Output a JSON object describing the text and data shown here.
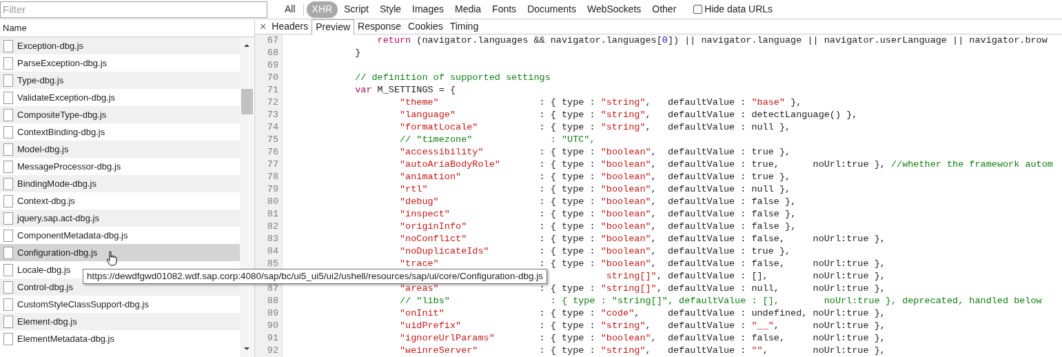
{
  "filter": {
    "placeholder": "Filter"
  },
  "type_filters": [
    {
      "label": "All",
      "selected": false
    },
    {
      "label": "XHR",
      "selected": true
    },
    {
      "label": "Script",
      "selected": false
    },
    {
      "label": "Style",
      "selected": false
    },
    {
      "label": "Images",
      "selected": false
    },
    {
      "label": "Media",
      "selected": false
    },
    {
      "label": "Fonts",
      "selected": false
    },
    {
      "label": "Documents",
      "selected": false
    },
    {
      "label": "WebSockets",
      "selected": false
    },
    {
      "label": "Other",
      "selected": false
    }
  ],
  "hide_data_urls": {
    "label": "Hide data URLs",
    "checked": false
  },
  "requests": {
    "column": "Name",
    "rows": [
      {
        "name": "Exception-dbg.js",
        "hovered": false
      },
      {
        "name": "ParseException-dbg.js",
        "hovered": false
      },
      {
        "name": "Type-dbg.js",
        "hovered": false
      },
      {
        "name": "ValidateException-dbg.js",
        "hovered": false
      },
      {
        "name": "CompositeType-dbg.js",
        "hovered": false
      },
      {
        "name": "ContextBinding-dbg.js",
        "hovered": false
      },
      {
        "name": "Model-dbg.js",
        "hovered": false
      },
      {
        "name": "MessageProcessor-dbg.js",
        "hovered": false
      },
      {
        "name": "BindingMode-dbg.js",
        "hovered": false
      },
      {
        "name": "Context-dbg.js",
        "hovered": false
      },
      {
        "name": "jquery.sap.act-dbg.js",
        "hovered": false
      },
      {
        "name": "ComponentMetadata-dbg.js",
        "hovered": false
      },
      {
        "name": "Configuration-dbg.js",
        "hovered": true
      },
      {
        "name": "Locale-dbg.js",
        "hovered": false
      },
      {
        "name": "Control-dbg.js",
        "hovered": false
      },
      {
        "name": "CustomStyleClassSupport-dbg.js",
        "hovered": false
      },
      {
        "name": "Element-dbg.js",
        "hovered": false
      },
      {
        "name": "ElementMetadata-dbg.js",
        "hovered": false
      }
    ]
  },
  "tooltip": "https://dewdfgwd01082.wdf.sap.corp:4080/sap/bc/ui5_ui5/ui2/ushell/resources/sap/ui/core/Configuration-dbg.js",
  "detail_tabs": {
    "close": "×",
    "tabs": [
      {
        "label": "Headers",
        "selected": false
      },
      {
        "label": "Preview",
        "selected": true
      },
      {
        "label": "Response",
        "selected": false
      },
      {
        "label": "Cookies",
        "selected": false
      },
      {
        "label": "Timing",
        "selected": false
      }
    ]
  },
  "code_lines": [
    {
      "number": "67",
      "kind": "inner",
      "tokens": [
        {
          "kind": "keyword",
          "text": "return"
        },
        {
          "kind": "plain",
          "text": " (navigator.languages && navigator.languages["
        },
        {
          "kind": "number",
          "text": "0"
        },
        {
          "kind": "plain",
          "text": "]) || navigator.language || navigator.userLanguage || navigator.brow"
        }
      ]
    },
    {
      "number": "68",
      "kind": "outer",
      "tokens": [
        {
          "kind": "plain",
          "text": "}"
        }
      ]
    },
    {
      "number": "69"
    },
    {
      "number": "70",
      "kind": "outer",
      "tokens": [
        {
          "kind": "comment",
          "text": "// definition of supported settings"
        }
      ]
    },
    {
      "number": "71",
      "kind": "outer",
      "tokens": [
        {
          "kind": "keyword",
          "text": "var"
        },
        {
          "kind": "plain",
          "text": " M_SETTINGS = {"
        }
      ]
    },
    {
      "number": "72",
      "kind": "entry",
      "tokens": [
        {
          "kind": "string",
          "text": "\"theme\""
        },
        {
          "kind": "plain",
          "text": "                  : { type : "
        },
        {
          "kind": "string",
          "text": "\"string\""
        },
        {
          "kind": "plain",
          "text": ",   defaultValue : "
        },
        {
          "kind": "string",
          "text": "\"base\""
        },
        {
          "kind": "plain",
          "text": " },"
        }
      ]
    },
    {
      "number": "73",
      "kind": "entry",
      "tokens": [
        {
          "kind": "string",
          "text": "\"language\""
        },
        {
          "kind": "plain",
          "text": "               : { type : "
        },
        {
          "kind": "string",
          "text": "\"string\""
        },
        {
          "kind": "plain",
          "text": ",   defaultValue : detectLanguage() },"
        }
      ]
    },
    {
      "number": "74",
      "kind": "entry",
      "tokens": [
        {
          "kind": "string",
          "text": "\"formatLocale\""
        },
        {
          "kind": "plain",
          "text": "           : { type : "
        },
        {
          "kind": "string",
          "text": "\"string\""
        },
        {
          "kind": "plain",
          "text": ",   defaultValue : null },"
        }
      ]
    },
    {
      "number": "75",
      "kind": "entry",
      "tokens": [
        {
          "kind": "comment",
          "text": "// \"timezone\"              : \"UTC\","
        }
      ]
    },
    {
      "number": "76",
      "kind": "entry",
      "tokens": [
        {
          "kind": "string",
          "text": "\"accessibility\""
        },
        {
          "kind": "plain",
          "text": "          : { type : "
        },
        {
          "kind": "string",
          "text": "\"boolean\""
        },
        {
          "kind": "plain",
          "text": ",  defaultValue : true },"
        }
      ]
    },
    {
      "number": "77",
      "kind": "entry",
      "tokens": [
        {
          "kind": "string",
          "text": "\"autoAriaBodyRole\""
        },
        {
          "kind": "plain",
          "text": "       : { type : "
        },
        {
          "kind": "string",
          "text": "\"boolean\""
        },
        {
          "kind": "plain",
          "text": ",  defaultValue : true,      noUrl:true }, "
        },
        {
          "kind": "comment",
          "text": "//whether the framework autom"
        }
      ]
    },
    {
      "number": "78",
      "kind": "entry",
      "tokens": [
        {
          "kind": "string",
          "text": "\"animation\""
        },
        {
          "kind": "plain",
          "text": "              : { type : "
        },
        {
          "kind": "string",
          "text": "\"boolean\""
        },
        {
          "kind": "plain",
          "text": ",  defaultValue : true },"
        }
      ]
    },
    {
      "number": "79",
      "kind": "entry",
      "tokens": [
        {
          "kind": "string",
          "text": "\"rtl\""
        },
        {
          "kind": "plain",
          "text": "                    : { type : "
        },
        {
          "kind": "string",
          "text": "\"boolean\""
        },
        {
          "kind": "plain",
          "text": ",  defaultValue : null },"
        }
      ]
    },
    {
      "number": "80",
      "kind": "entry",
      "tokens": [
        {
          "kind": "string",
          "text": "\"debug\""
        },
        {
          "kind": "plain",
          "text": "                  : { type : "
        },
        {
          "kind": "string",
          "text": "\"boolean\""
        },
        {
          "kind": "plain",
          "text": ",  defaultValue : false },"
        }
      ]
    },
    {
      "number": "81",
      "kind": "entry",
      "tokens": [
        {
          "kind": "string",
          "text": "\"inspect\""
        },
        {
          "kind": "plain",
          "text": "                : { type : "
        },
        {
          "kind": "string",
          "text": "\"boolean\""
        },
        {
          "kind": "plain",
          "text": ",  defaultValue : false },"
        }
      ]
    },
    {
      "number": "82",
      "kind": "entry",
      "tokens": [
        {
          "kind": "string",
          "text": "\"originInfo\""
        },
        {
          "kind": "plain",
          "text": "             : { type : "
        },
        {
          "kind": "string",
          "text": "\"boolean\""
        },
        {
          "kind": "plain",
          "text": ",  defaultValue : false },"
        }
      ]
    },
    {
      "number": "83",
      "kind": "entry",
      "tokens": [
        {
          "kind": "string",
          "text": "\"noConflict\""
        },
        {
          "kind": "plain",
          "text": "             : { type : "
        },
        {
          "kind": "string",
          "text": "\"boolean\""
        },
        {
          "kind": "plain",
          "text": ",  defaultValue : false,     noUrl:true },"
        }
      ]
    },
    {
      "number": "84",
      "kind": "entry",
      "tokens": [
        {
          "kind": "string",
          "text": "\"noDuplicateIds\""
        },
        {
          "kind": "plain",
          "text": "         : { type : "
        },
        {
          "kind": "string",
          "text": "\"boolean\""
        },
        {
          "kind": "plain",
          "text": ",  defaultValue : true },"
        }
      ]
    },
    {
      "number": "85",
      "kind": "entry",
      "tokens": [
        {
          "kind": "string",
          "text": "\"trace\""
        },
        {
          "kind": "plain",
          "text": "                  : { type : "
        },
        {
          "kind": "string",
          "text": "\"boolean\""
        },
        {
          "kind": "plain",
          "text": ",  defaultValue : false,     noUrl:true },"
        }
      ]
    },
    {
      "kind": "covered",
      "tokens": [
        {
          "kind": "string",
          "text": "string[]\""
        },
        {
          "kind": "plain",
          "text": ", defaultValue : [],        noUrl:true },"
        }
      ]
    },
    {
      "number": "87",
      "kind": "entry",
      "tokens": [
        {
          "kind": "string",
          "text": "\"areas\""
        },
        {
          "kind": "plain",
          "text": "                  : { type : "
        },
        {
          "kind": "string",
          "text": "\"string[]\""
        },
        {
          "kind": "plain",
          "text": ", defaultValue : null,      noUrl:true },"
        }
      ]
    },
    {
      "number": "88",
      "kind": "entry",
      "tokens": [
        {
          "kind": "comment",
          "text": "// \"libs\"                  : { type : \"string[]\", defaultValue : [],        noUrl:true }, deprecated, handled below"
        }
      ]
    },
    {
      "number": "89",
      "kind": "entry",
      "tokens": [
        {
          "kind": "string",
          "text": "\"onInit\""
        },
        {
          "kind": "plain",
          "text": "                 : { type : "
        },
        {
          "kind": "string",
          "text": "\"code\""
        },
        {
          "kind": "plain",
          "text": ",     defaultValue : undefined, noUrl:true },"
        }
      ]
    },
    {
      "number": "90",
      "kind": "entry",
      "tokens": [
        {
          "kind": "string",
          "text": "\"uidPrefix\""
        },
        {
          "kind": "plain",
          "text": "              : { type : "
        },
        {
          "kind": "string",
          "text": "\"string\""
        },
        {
          "kind": "plain",
          "text": ",   defaultValue : "
        },
        {
          "kind": "string",
          "text": "\"__\""
        },
        {
          "kind": "plain",
          "text": ",      noUrl:true },"
        }
      ]
    },
    {
      "number": "91",
      "kind": "entry",
      "tokens": [
        {
          "kind": "string",
          "text": "\"ignoreUrlParams\""
        },
        {
          "kind": "plain",
          "text": "        : { type : "
        },
        {
          "kind": "string",
          "text": "\"boolean\""
        },
        {
          "kind": "plain",
          "text": ",  defaultValue : false,     noUrl:true },"
        }
      ]
    },
    {
      "number": "92",
      "kind": "entry",
      "tokens": [
        {
          "kind": "string",
          "text": "\"weinreServer\""
        },
        {
          "kind": "plain",
          "text": "           : { type : "
        },
        {
          "kind": "string",
          "text": "\"string\""
        },
        {
          "kind": "plain",
          "text": ",   defaultValue : "
        },
        {
          "kind": "string",
          "text": "\"\""
        },
        {
          "kind": "plain",
          "text": ",        noUrl:true },"
        }
      ]
    }
  ]
}
